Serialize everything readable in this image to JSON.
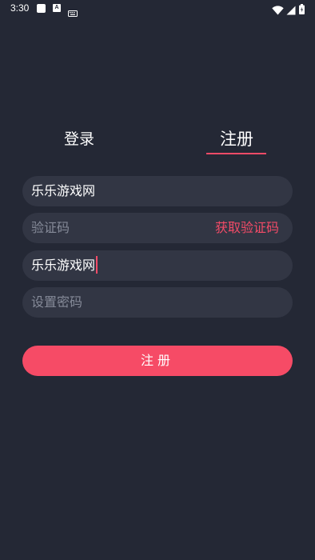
{
  "status_bar": {
    "time": "3:30",
    "notification_icons": [
      "square-icon",
      "a-badge-icon",
      "keyboard-icon"
    ],
    "system_icons": [
      "wifi-icon",
      "signal-icon",
      "battery-icon"
    ]
  },
  "tabs": {
    "login_label": "登录",
    "register_label": "注册",
    "active": "register"
  },
  "form": {
    "field1_value": "乐乐游戏网",
    "code_placeholder": "验证码",
    "get_code_label": "获取验证码",
    "field3_value": "乐乐游戏网",
    "password_placeholder": "设置密码",
    "submit_label": "注册"
  },
  "colors": {
    "background": "#242835",
    "input_background": "#323644",
    "accent": "#f64b66",
    "placeholder": "#858a98"
  }
}
